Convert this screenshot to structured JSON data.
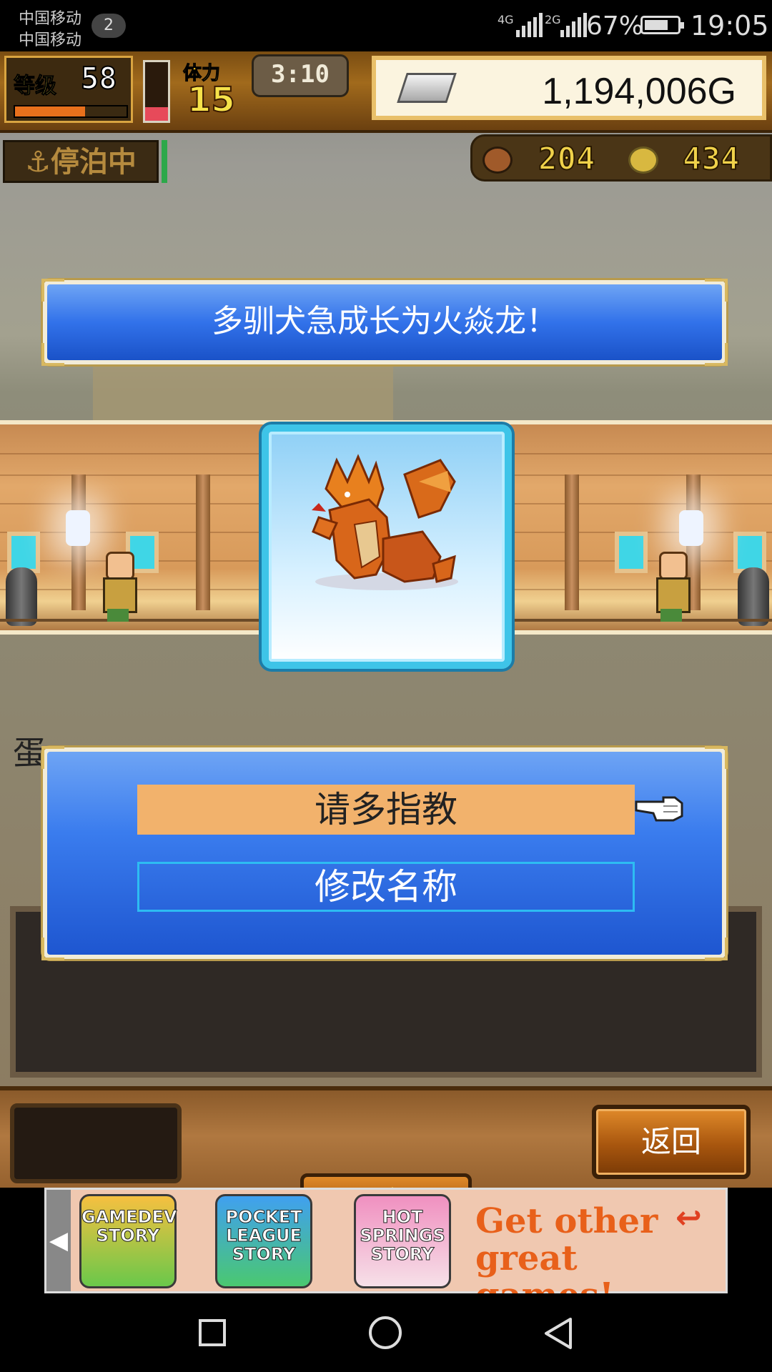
{
  "status_bar": {
    "carrier_1": "中国移动",
    "carrier_2": "中国移动",
    "notification_count": "2",
    "network_1": "4G",
    "network_2": "2G",
    "battery": "67%",
    "time": "19:05"
  },
  "hud": {
    "level_label": "等级",
    "level_value": "58",
    "exp_fraction": 0.63,
    "stamina_label": "体力",
    "stamina_value": "15",
    "stamina_fraction": 0.23,
    "timer": "3:10",
    "gold": "1,194,006G",
    "status": "停泊中",
    "resource_1": "204",
    "resource_2": "434"
  },
  "banner": {
    "message": "多驯犬急成长为火焱龙！"
  },
  "portrait": {
    "subject_icon": "fire-dragon-icon"
  },
  "egg_label": "蛋",
  "dialog": {
    "option_1": "请多指教",
    "option_2": "修改名称"
  },
  "buttons": {
    "back": "返回"
  },
  "ad": {
    "tiles": [
      "GAMEDEV STORY",
      "POCKET LEAGUE STORY",
      "HOT SPRINGS STORY"
    ],
    "tagline_1": "Get other",
    "tagline_2": "great games!"
  },
  "colors": {
    "dialog_blue": "#3a7cee",
    "option_highlight": "#f2b26c",
    "gold_text": "#f6e24a"
  }
}
